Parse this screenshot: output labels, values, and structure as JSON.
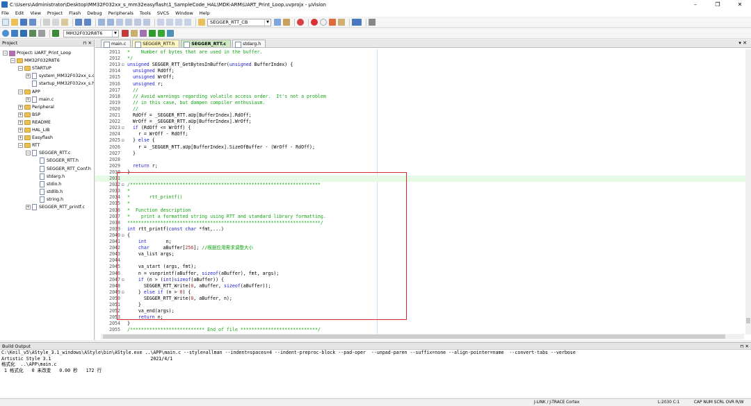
{
  "window": {
    "title": "C:\\Users\\Administrator\\Desktop\\MM32F032xx_s_mm32easyflash\\1_SampleCode_HAL\\MDK-ARM\\UART_Print_Loop.uvprojx - µVision",
    "minimize": "–",
    "maximize": "❐",
    "close": "✕"
  },
  "menu": [
    "File",
    "Edit",
    "View",
    "Project",
    "Flash",
    "Debug",
    "Peripherals",
    "Tools",
    "SVCS",
    "Window",
    "Help"
  ],
  "toolbar": {
    "find_combo": "SEGGER_RTT_CB",
    "target_combo": "MM32F032R8T6"
  },
  "project_panel": {
    "title": "Project",
    "pin": "⊓ ✕",
    "tree": [
      {
        "label": "Project: UART_Print_Loop",
        "level": 0,
        "exp": "−",
        "icon": "proj"
      },
      {
        "label": "MM32F032R8T6",
        "level": 1,
        "exp": "−",
        "icon": "fold"
      },
      {
        "label": "STARTUP",
        "level": 2,
        "exp": "−",
        "icon": "fold"
      },
      {
        "label": "system_MM32F032xx_s.c",
        "level": 3,
        "exp": "+",
        "icon": "file"
      },
      {
        "label": "startup_MM32F032xx_s.h",
        "level": 3,
        "exp": "",
        "icon": "file"
      },
      {
        "label": "APP",
        "level": 2,
        "exp": "−",
        "icon": "fold"
      },
      {
        "label": "main.c",
        "level": 3,
        "exp": "+",
        "icon": "file"
      },
      {
        "label": "Peripheral",
        "level": 2,
        "exp": "+",
        "icon": "fold"
      },
      {
        "label": "BSP",
        "level": 2,
        "exp": "+",
        "icon": "fold"
      },
      {
        "label": "README",
        "level": 2,
        "exp": "+",
        "icon": "fold"
      },
      {
        "label": "HAL_LIB",
        "level": 2,
        "exp": "+",
        "icon": "fold"
      },
      {
        "label": "Easyflash",
        "level": 2,
        "exp": "+",
        "icon": "fold"
      },
      {
        "label": "RTT",
        "level": 2,
        "exp": "−",
        "icon": "fold"
      },
      {
        "label": "SEGGER_RTT.c",
        "level": 3,
        "exp": "−",
        "icon": "file"
      },
      {
        "label": "SEGGER_RTT.h",
        "level": 4,
        "exp": "",
        "icon": "file"
      },
      {
        "label": "SEGGER_RTT_Conf.h",
        "level": 4,
        "exp": "",
        "icon": "file"
      },
      {
        "label": "stdarg.h",
        "level": 4,
        "exp": "",
        "icon": "file"
      },
      {
        "label": "stdio.h",
        "level": 4,
        "exp": "",
        "icon": "file"
      },
      {
        "label": "stdlib.h",
        "level": 4,
        "exp": "",
        "icon": "file"
      },
      {
        "label": "string.h",
        "level": 4,
        "exp": "",
        "icon": "file"
      },
      {
        "label": "SEGGER_RTT_printf.c",
        "level": 3,
        "exp": "+",
        "icon": "file"
      }
    ],
    "tabs": [
      "Project",
      "Books",
      "{} Func...",
      "0+ Temp..."
    ]
  },
  "editor": {
    "tabs": [
      {
        "label": "main.c",
        "style": "normal"
      },
      {
        "label": "SEGGER_RTT.h",
        "style": "yellow"
      },
      {
        "label": "SEGGER_RTT.c",
        "style": "green"
      },
      {
        "label": "stdarg.h",
        "style": "normal"
      }
    ],
    "close_all": "▾ ✕",
    "lines": [
      {
        "n": "2011",
        "f": "",
        "t": "*    Number of bytes that are used in the buffer.",
        "c": "cmt"
      },
      {
        "n": "2012",
        "f": "",
        "t": "*/",
        "c": "cmt"
      },
      {
        "n": "2013",
        "f": "⊟",
        "t": "unsigned SEGGER_RTT_GetBytesInBuffer(unsigned BufferIndex) {",
        "c": ""
      },
      {
        "n": "2014",
        "f": "",
        "t": "  unsigned RdOff;",
        "c": ""
      },
      {
        "n": "2015",
        "f": "",
        "t": "  unsigned WrOff;",
        "c": ""
      },
      {
        "n": "2016",
        "f": "",
        "t": "  unsigned r;",
        "c": ""
      },
      {
        "n": "2017",
        "f": "",
        "t": "  //",
        "c": "cmt"
      },
      {
        "n": "2018",
        "f": "",
        "t": "  // Avoid warnings regarding volatile access order.  It's not a problem",
        "c": "cmt"
      },
      {
        "n": "2019",
        "f": "",
        "t": "  // in this case, but dampen compiler enthusiasm.",
        "c": "cmt"
      },
      {
        "n": "2020",
        "f": "",
        "t": "  //",
        "c": "cmt"
      },
      {
        "n": "2021",
        "f": "",
        "t": "  RdOff = _SEGGER_RTT.aUp[BufferIndex].RdOff;",
        "c": ""
      },
      {
        "n": "2022",
        "f": "",
        "t": "  WrOff = _SEGGER_RTT.aUp[BufferIndex].WrOff;",
        "c": ""
      },
      {
        "n": "2023",
        "f": "⊟",
        "t": "  if (RdOff <= WrOff) {",
        "c": ""
      },
      {
        "n": "2024",
        "f": "",
        "t": "    r = WrOff - RdOff;",
        "c": ""
      },
      {
        "n": "2025",
        "f": "⊟",
        "t": "  } else {",
        "c": ""
      },
      {
        "n": "2026",
        "f": "",
        "t": "    r = _SEGGER_RTT.aUp[BufferIndex].SizeOfBuffer - (WrOff - RdOff);",
        "c": ""
      },
      {
        "n": "2027",
        "f": "",
        "t": "  }",
        "c": ""
      },
      {
        "n": "2028",
        "f": "",
        "t": "",
        "c": ""
      },
      {
        "n": "2029",
        "f": "",
        "t": "  return r;",
        "c": ""
      },
      {
        "n": "2030",
        "f": "",
        "t": "}",
        "c": ""
      },
      {
        "n": "2031",
        "f": "",
        "t": "",
        "c": "cur"
      },
      {
        "n": "2032",
        "f": "⊟",
        "t": "/*********************************************************************",
        "c": "cmt"
      },
      {
        "n": "2033",
        "f": "",
        "t": "*",
        "c": "cmt"
      },
      {
        "n": "2034",
        "f": "",
        "t": "*       rtt_printf()",
        "c": "cmt"
      },
      {
        "n": "2035",
        "f": "",
        "t": "*",
        "c": "cmt"
      },
      {
        "n": "2036",
        "f": "",
        "t": "*  Function description",
        "c": "cmt"
      },
      {
        "n": "2037",
        "f": "",
        "t": "*    print a formatted string using RTT and standard library formatting.",
        "c": "cmt"
      },
      {
        "n": "2038",
        "f": "",
        "t": "**********************************************************************/",
        "c": "cmt"
      },
      {
        "n": "2039",
        "f": "",
        "t": "int rtt_printf(const char *fmt,...)",
        "c": ""
      },
      {
        "n": "2040",
        "f": "⊟",
        "t": "{",
        "c": ""
      },
      {
        "n": "2041",
        "f": "",
        "t": "    int       n;",
        "c": ""
      },
      {
        "n": "2042",
        "f": "",
        "t": "    char     aBuffer[256]; //根据应用需求调整大小",
        "c": ""
      },
      {
        "n": "2043",
        "f": "",
        "t": "    va_list args;",
        "c": ""
      },
      {
        "n": "2044",
        "f": "",
        "t": "",
        "c": ""
      },
      {
        "n": "2045",
        "f": "",
        "t": "    va_start (args, fmt);",
        "c": ""
      },
      {
        "n": "2046",
        "f": "",
        "t": "    n = vsnprintf(aBuffer, sizeof(aBuffer), fmt, args);",
        "c": ""
      },
      {
        "n": "2047",
        "f": "⊟",
        "t": "    if (n > (int)sizeof(aBuffer)) {",
        "c": ""
      },
      {
        "n": "2048",
        "f": "",
        "t": "      SEGGER_RTT_Write(0, aBuffer, sizeof(aBuffer));",
        "c": ""
      },
      {
        "n": "2049",
        "f": "⊟",
        "t": "    } else if (n > 0) {",
        "c": ""
      },
      {
        "n": "2050",
        "f": "",
        "t": "      SEGGER_RTT_Write(0, aBuffer, n);",
        "c": ""
      },
      {
        "n": "2051",
        "f": "",
        "t": "    }",
        "c": ""
      },
      {
        "n": "2052",
        "f": "",
        "t": "    va_end(args);",
        "c": ""
      },
      {
        "n": "2053",
        "f": "",
        "t": "    return n;",
        "c": ""
      },
      {
        "n": "2054",
        "f": "",
        "t": "}",
        "c": ""
      },
      {
        "n": "2055",
        "f": "",
        "t": "/*************************** End of file ****************************/",
        "c": "cmt"
      },
      {
        "n": "2056",
        "f": "",
        "t": "",
        "c": ""
      }
    ]
  },
  "build_output": {
    "title": "Build Output",
    "pin": "⊓ ✕",
    "lines": [
      "C:\\Keil_v5\\AStyle_3.1_windows\\AStyle\\bin\\AStyle.exe ..\\APP\\main.c --style=allman --indent=spaces=4 --indent-preproc-block --pad-oper  --unpad-paren --suffix=none --align-pointer=name  --convert-tabs --verbose",
      "Artistic Style 3.1                                    2021/4/1",
      "格式化  ..\\APP\\main.c",
      " 1 格式化   0 未改变   0.00 秒   172 行"
    ]
  },
  "status": {
    "debugger": "J-LINK / J-TRACE Cortex",
    "position": "L:2030 C:1",
    "flags": "CAP NUM SCRL OVR R/W"
  }
}
